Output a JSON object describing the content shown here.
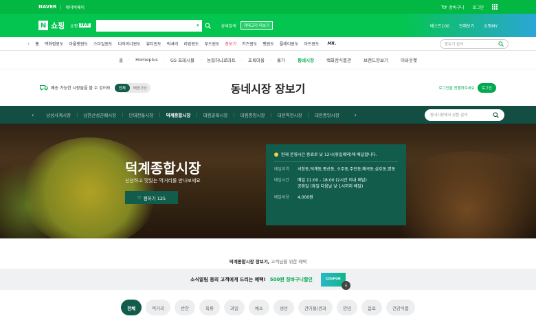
{
  "gnb": {
    "naver": "NAVER",
    "naverpay": "네이버페이",
    "cart": "장바구니",
    "login": "로그인"
  },
  "header": {
    "logo_n": "N",
    "logo": "쇼핑",
    "live_prefix": "쇼핑",
    "live_tag": "LIVE",
    "detail_search": "상세검색",
    "category_more": "카테고리 더보기",
    "best": "베스트100",
    "all_services": "전체보기",
    "my": "쇼핑MY"
  },
  "subnav": {
    "items": [
      {
        "label": "홈"
      },
      {
        "label": "백화점윈도"
      },
      {
        "label": "아울렛윈도"
      },
      {
        "label": "스타일윈도"
      },
      {
        "label": "디자이너윈도"
      },
      {
        "label": "뷰티윈도"
      },
      {
        "label": "럭셔리"
      },
      {
        "label": "리빙윈도"
      },
      {
        "label": "푸드윈도"
      },
      {
        "label": "장보기"
      },
      {
        "label": "키즈윈도"
      },
      {
        "label": "펫윈도"
      },
      {
        "label": "플레이윈도"
      },
      {
        "label": "아트윈도"
      }
    ],
    "mr": "MR.",
    "search_placeholder": "장보기 검색"
  },
  "markets": {
    "items": [
      {
        "label": "홈"
      },
      {
        "label": "Homeplus"
      },
      {
        "label": "GS 프레시몰"
      },
      {
        "label": "농협하나로마트"
      },
      {
        "label": "초록마을"
      },
      {
        "label": "홀가"
      },
      {
        "label": "동네시장"
      },
      {
        "label": "백화점식품관"
      },
      {
        "label": "브랜드장보기"
      },
      {
        "label": "어바웃펫"
      }
    ]
  },
  "title_row": {
    "delivery": "배송 가능한 시장들을 볼 수 있어요.",
    "toggle_all": "전체",
    "toggle_avail": "배송가능",
    "page_title": "동네시장 장보기",
    "login_prompt": "로그인을 진행하주세요",
    "login_button": "로그인"
  },
  "market_nav": {
    "items": [
      {
        "label": "남성사계시장"
      },
      {
        "label": "남한산성곤배시장"
      },
      {
        "label": "단대전통시장"
      },
      {
        "label": "덕계종합시장"
      },
      {
        "label": "대림골목시장"
      },
      {
        "label": "대림중앙시장"
      },
      {
        "label": "대전역전시장"
      },
      {
        "label": "대전중앙시장"
      }
    ],
    "search_placeholder": "동네시장에서 상품 검색"
  },
  "hero": {
    "name": "덕계종합시장",
    "desc": "신선하고 맛있는 먹거리를 만나보세요",
    "wish": "찜하기 125"
  },
  "info": {
    "notice": "현재 운영시간 종료로 낮 12시(휴일제외)에 배달합니다.",
    "area_label": "배달지역",
    "area": "서창동,덕계동,평산동, 소주동,주진동,매곡동,삼호동,명동",
    "time_label": "배달시간",
    "time1": "매일 11:00 - 18:00 (2시간 이내 배달)",
    "time2": "공휴일 (휴일 다음날 낮 1시까지 배달)",
    "fee_label": "배달비용",
    "fee": "4,000원"
  },
  "section": {
    "title": "덕계종합시장 장보기,",
    "sub": "고객님을 위한 혜택"
  },
  "coupon": {
    "text": "소식알림 동의 고객에게 드리는 혜택!",
    "highlight": "500원 장바구니할인",
    "ticket": "COUPON"
  },
  "chips": [
    {
      "label": "전체"
    },
    {
      "label": "먹거리"
    },
    {
      "label": "반찬"
    },
    {
      "label": "육류"
    },
    {
      "label": "과일"
    },
    {
      "label": "채소"
    },
    {
      "label": "생선"
    },
    {
      "label": "건어물/견과"
    },
    {
      "label": "양념"
    },
    {
      "label": "음료"
    },
    {
      "label": "건강식품"
    }
  ],
  "colors": {
    "brand_green": "#03c75a",
    "market_green": "#115c4b",
    "accent_red": "#e1314b"
  }
}
